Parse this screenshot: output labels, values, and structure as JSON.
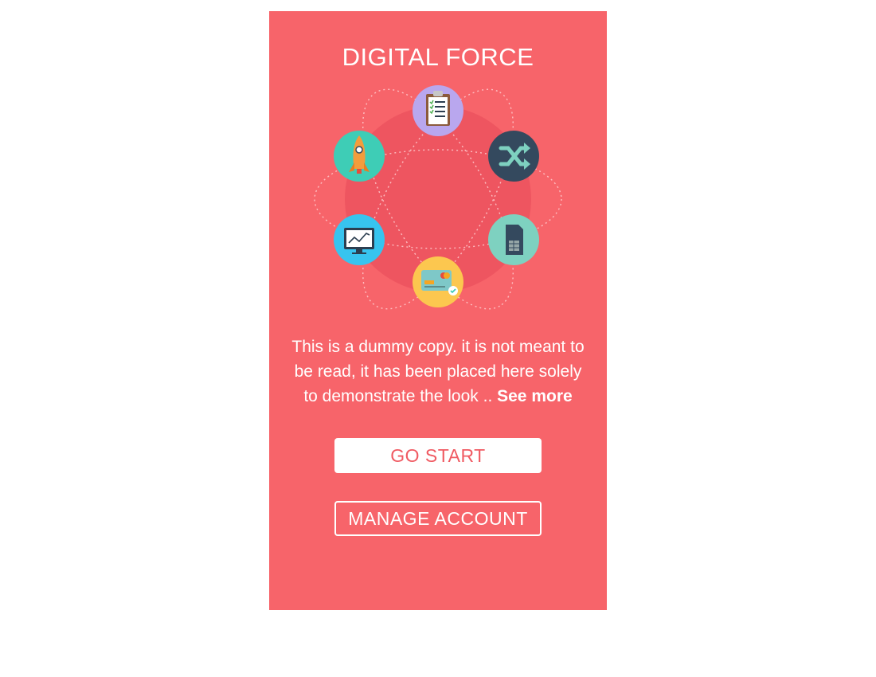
{
  "app": {
    "title": "DIGITAL FORCE"
  },
  "hero": {
    "icons": [
      {
        "name": "clipboard-icon",
        "color": "#b9a7ee"
      },
      {
        "name": "shuffle-icon",
        "color": "#34495e"
      },
      {
        "name": "sim-card-icon",
        "color": "#7ed1c0"
      },
      {
        "name": "credit-card-icon",
        "color": "#fcc74f"
      },
      {
        "name": "monitor-chart-icon",
        "color": "#37c4ef"
      },
      {
        "name": "rocket-icon",
        "color": "#3ecdb6"
      }
    ],
    "center_circle_color": "#ee5560"
  },
  "description": {
    "text": "This is a dummy copy. it is not meant to be read, it has been placed here solely to demonstrate the look .. ",
    "see_more": "See more"
  },
  "buttons": {
    "start_label": "GO START",
    "manage_label": "MANAGE ACCOUNT"
  },
  "colors": {
    "background": "#f7646a",
    "accent_text": "#f05a62",
    "white": "#ffffff"
  }
}
